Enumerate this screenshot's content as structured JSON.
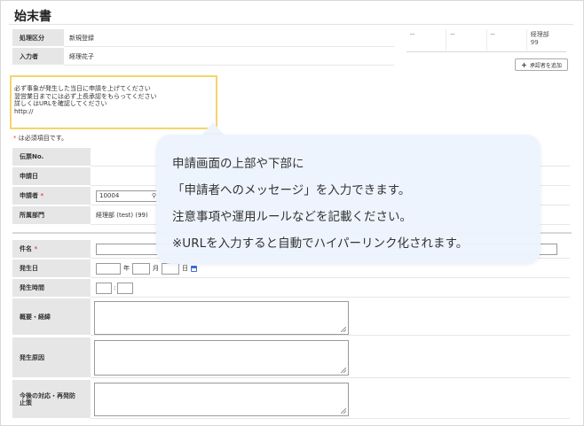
{
  "page": {
    "title": "始末書"
  },
  "header_fields": [
    {
      "label": "処理区分",
      "value": "新規登録"
    },
    {
      "label": "入力者",
      "value": "経理花子"
    }
  ],
  "approval": {
    "cells": [
      "--",
      "--",
      "--",
      "経理部\n99"
    ],
    "add_button": "承認者を追加"
  },
  "applicant_message": {
    "lines": [
      "必ず事象が発生した当日に申請を上げてください",
      "翌営業日までには必ず上長承認をもらってください",
      "詳しくはURLを確認してください",
      "http://"
    ]
  },
  "required_note": {
    "mark": "*",
    "text": " は必須項目です。"
  },
  "form_top": {
    "slip_no": {
      "label": "伝票No.",
      "value": ""
    },
    "apply_date": {
      "label": "申請日",
      "value": ""
    },
    "applicant": {
      "label": "申請者",
      "required_mark": "*",
      "value": "10004"
    },
    "department": {
      "label": "所属部門",
      "value": "経理部 (test) (99)"
    }
  },
  "form_bottom": {
    "subject": {
      "label": "件名",
      "required_mark": "*"
    },
    "occur_date": {
      "label": "発生日",
      "year": "年",
      "month": "月",
      "day": "日"
    },
    "occur_time": {
      "label": "発生時間",
      "sep": ":"
    },
    "summary": {
      "label": "概要・経緯"
    },
    "cause": {
      "label": "発生原因"
    },
    "future": {
      "label": "今後の対応・再発防\n止策"
    }
  },
  "tooltip": {
    "lines": [
      "申請画面の上部や下部に",
      "「申請者へのメッセージ」を入力できます。",
      "注意事項や運用ルールなどを記載ください。",
      "※URLを入力すると自動でハイパーリンク化されます。"
    ]
  }
}
